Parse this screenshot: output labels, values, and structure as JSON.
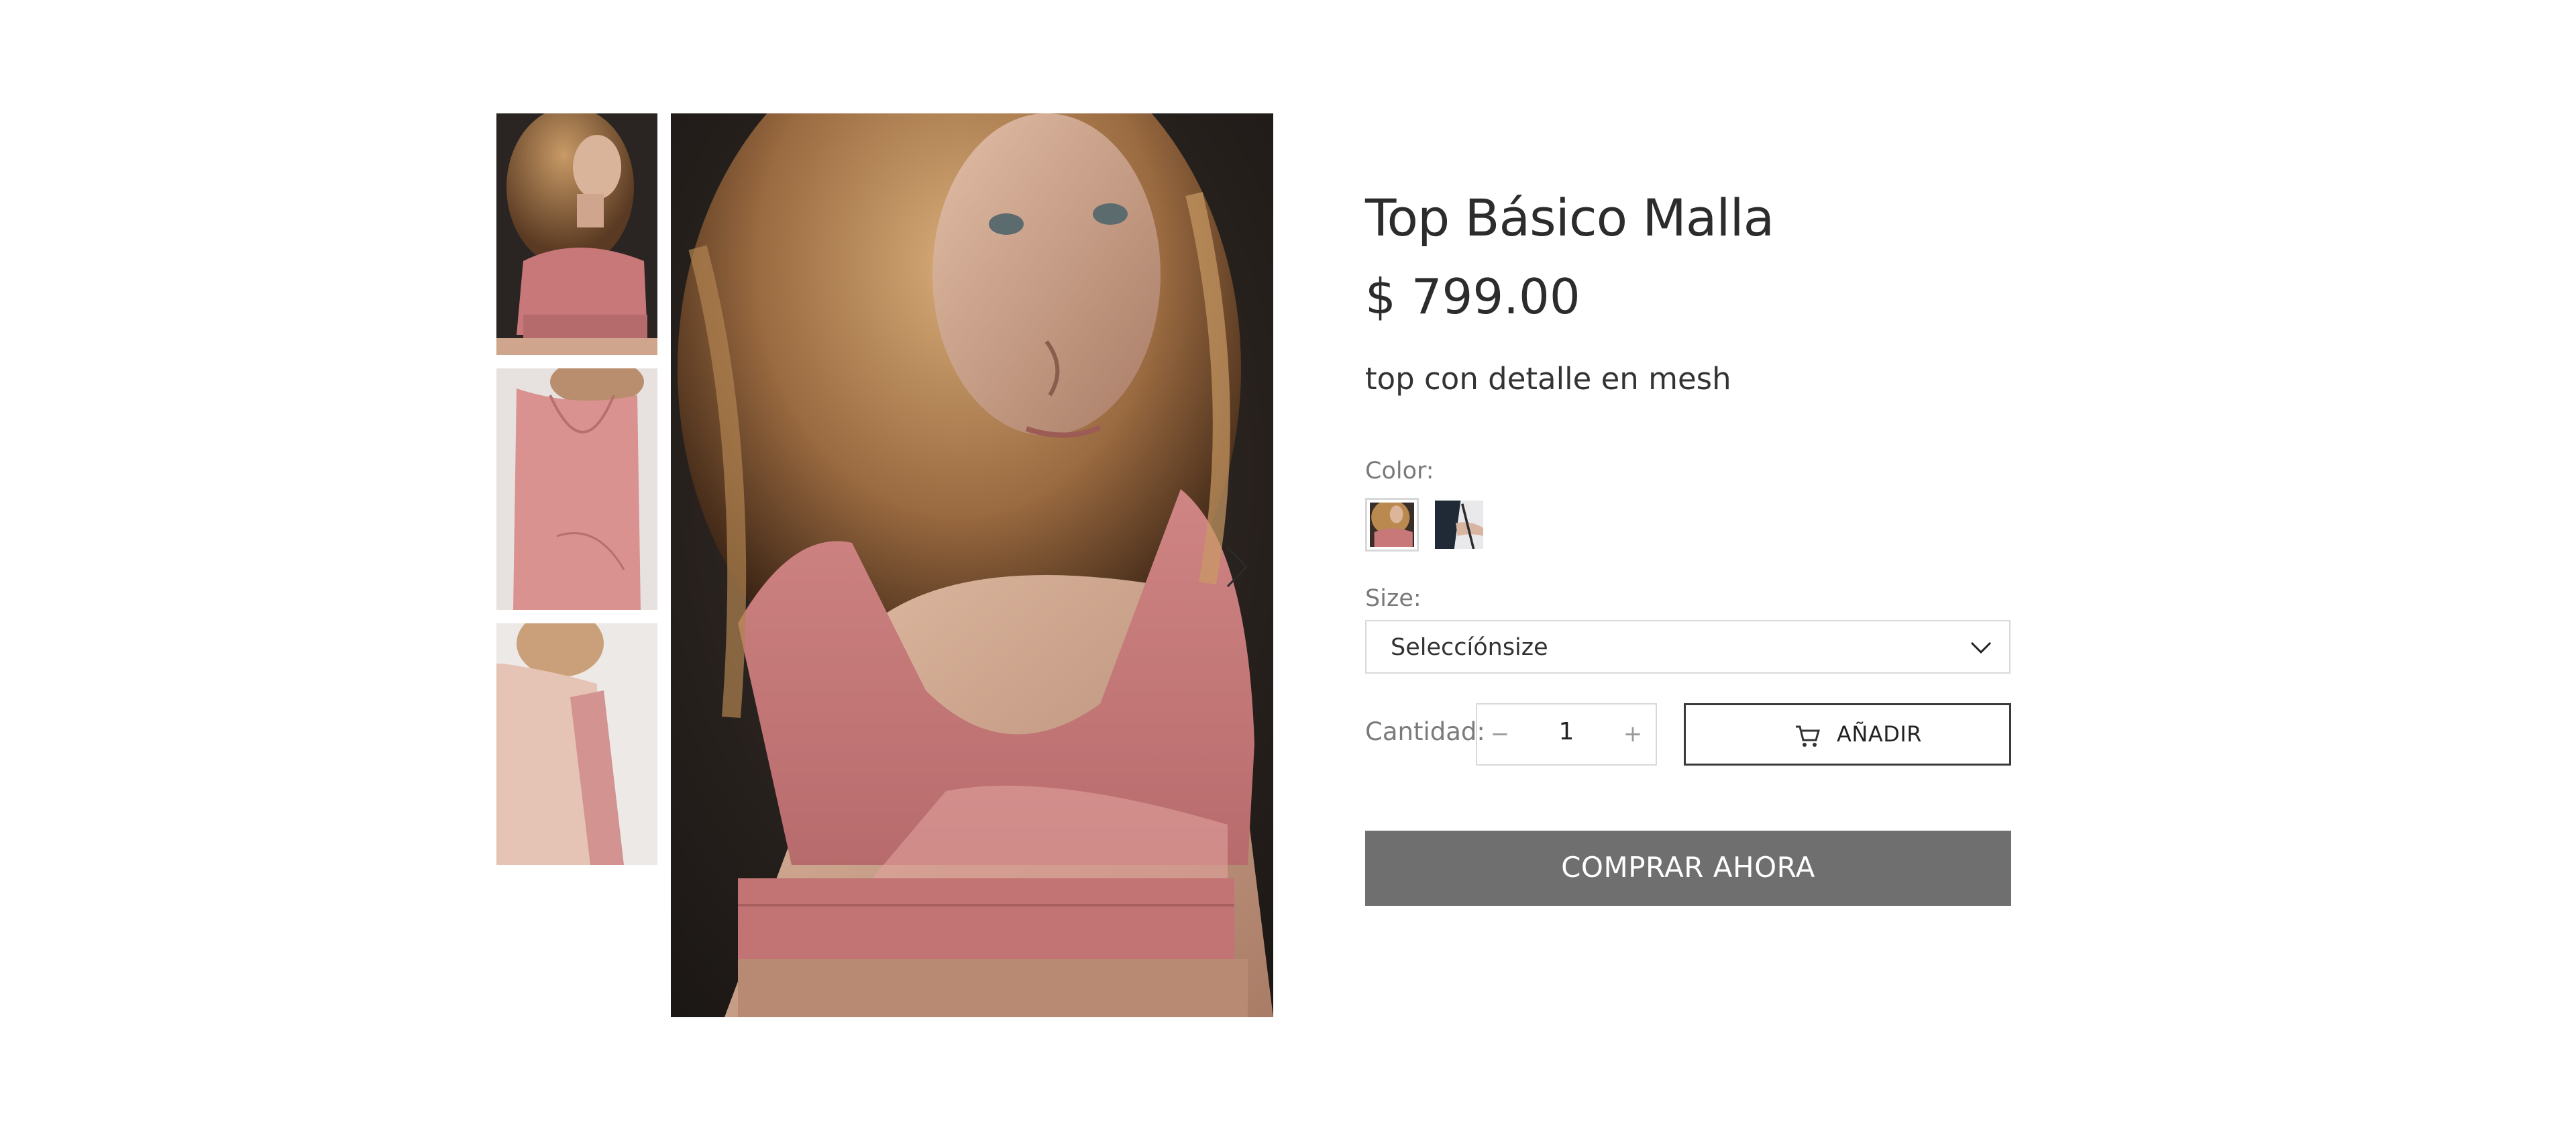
{
  "product": {
    "title": "Top Básico Malla",
    "price": "$ 799.00",
    "description": "top con detalle en mesh"
  },
  "options": {
    "color_label": "Color:",
    "size_label": "Size:",
    "size_value": "Seleccíónsize",
    "quantity_label": "Cantidad:",
    "quantity_value": "1",
    "quantity_minus": "−",
    "quantity_plus": "+"
  },
  "actions": {
    "add_label": "AÑADIR",
    "buy_label": "COMPRAR AHORA"
  },
  "icons": [
    "chevron-right-icon",
    "chevron-down-icon",
    "cart-icon"
  ],
  "colors": {
    "buy_button": "#6f6f6f",
    "add_border": "#3a3a3a",
    "input_border": "#d9d9d9",
    "label_gray": "#7a7a7a",
    "product_pink": "#c9787a"
  }
}
